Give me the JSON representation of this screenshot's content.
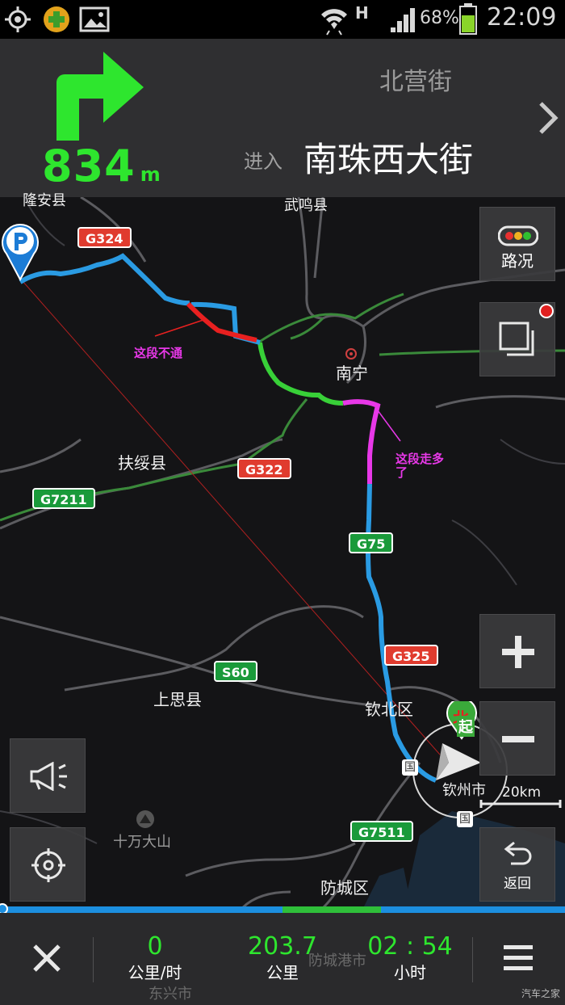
{
  "status_bar": {
    "network": "H",
    "battery": "68%",
    "battery_level": 0.68,
    "time": "22:09"
  },
  "navigation": {
    "distance": "834",
    "distance_unit": "m",
    "current_road": "北营街",
    "enter_label": "进入",
    "next_road": "南珠西大街"
  },
  "map": {
    "places": [
      "隆安县",
      "武鸣县",
      "南宁",
      "扶绥县",
      "上思县",
      "钦北区",
      "钦州市",
      "十万大山",
      "防城区",
      "防城港市",
      "东兴市"
    ],
    "shields": [
      "G324",
      "G322",
      "G7211",
      "G75",
      "G325",
      "S60",
      "G7511"
    ],
    "annotations": {
      "blocked": "这段不通",
      "detour": "这段走多了"
    },
    "compass_label": "北",
    "scale": "20km",
    "route_badge": "起",
    "poi_badge_top": "国",
    "poi_badge_bottom": "国"
  },
  "controls": {
    "traffic_label": "路况",
    "back_label": "返回",
    "zoom_in": "+",
    "zoom_out": "−"
  },
  "trip": {
    "speed": "0",
    "speed_unit": "公里/时",
    "distance_remaining": "203.7",
    "distance_unit": "公里",
    "time_remaining": "02 : 54",
    "time_unit": "小时",
    "progress": 0.5
  },
  "watermark": "汽车之家",
  "colors": {
    "route": "#2a9be3",
    "accent": "#2ee62e",
    "blocked": "#e82020",
    "detour": "#e838e8"
  }
}
